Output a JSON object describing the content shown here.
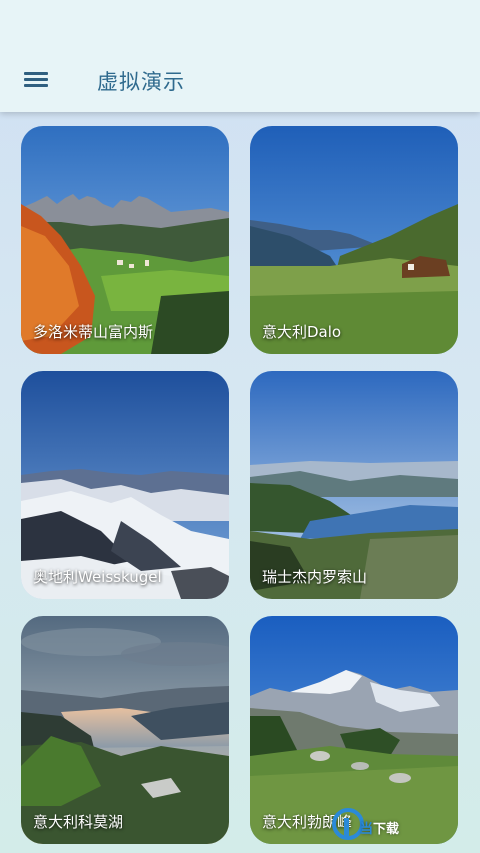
{
  "header": {
    "title": "虚拟演示",
    "menu_icon": "hamburger-menu-icon"
  },
  "cards": [
    {
      "caption": "多洛米蒂山富内斯"
    },
    {
      "caption": "意大利Dalo"
    },
    {
      "caption": "奥地利Weisskugel"
    },
    {
      "caption": "瑞士杰内罗索山"
    },
    {
      "caption": "意大利科莫湖"
    },
    {
      "caption": "意大利勃朗峰"
    }
  ],
  "watermark": {
    "text_a": "当",
    "text_b": "下载",
    "logo_icon": "watermark-logo-icon"
  },
  "colors": {
    "appbar": "#e7f4f7",
    "title": "#2f6a8e",
    "menu": "#2f5f80"
  }
}
